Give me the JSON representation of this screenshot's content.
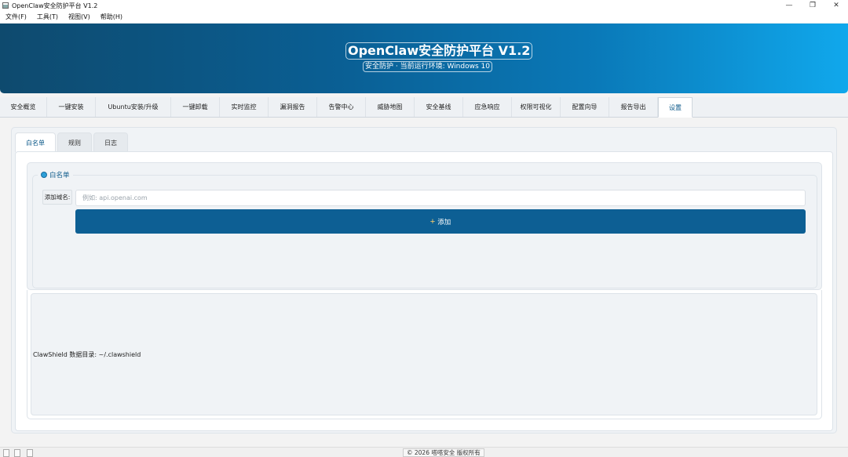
{
  "window": {
    "title": "OpenClaw安全防护平台 V1.2",
    "minimize": "—",
    "restore": "❐",
    "close": "✕"
  },
  "menu": [
    "文件(F)",
    "工具(T)",
    "视图(V)",
    "帮助(H)"
  ],
  "banner": {
    "title": "OpenClaw安全防护平台 V1.2",
    "subtitle": "安全防护 · 当前运行环境: Windows 10"
  },
  "main_tabs": [
    "安全概览",
    "一键安装",
    "Ubuntu安装/升级",
    "一键卸载",
    "实时监控",
    "漏洞报告",
    "告警中心",
    "威胁地图",
    "安全基线",
    "应急响应",
    "权限可视化",
    "配置向导",
    "报告导出",
    "设置"
  ],
  "active_main_tab": "设置",
  "sub_tabs": [
    "白名单",
    "规则",
    "日志"
  ],
  "active_sub_tab": "白名单",
  "whitelist": {
    "group_title": "白名单",
    "field_label": "添加域名:",
    "input_value": "",
    "input_placeholder": "例如: api.openai.com",
    "add_button": "添加",
    "add_icon": "plus-icon"
  },
  "data_dir_text": "ClawShield 数据目录: ~/.clawshield",
  "status_bar": {
    "copyright": "© 2026 嗒嗒安全 版权所有"
  },
  "colors": {
    "accent": "#0d5f94",
    "banner_start": "#0e4a6e",
    "banner_end": "#10a8ec"
  }
}
